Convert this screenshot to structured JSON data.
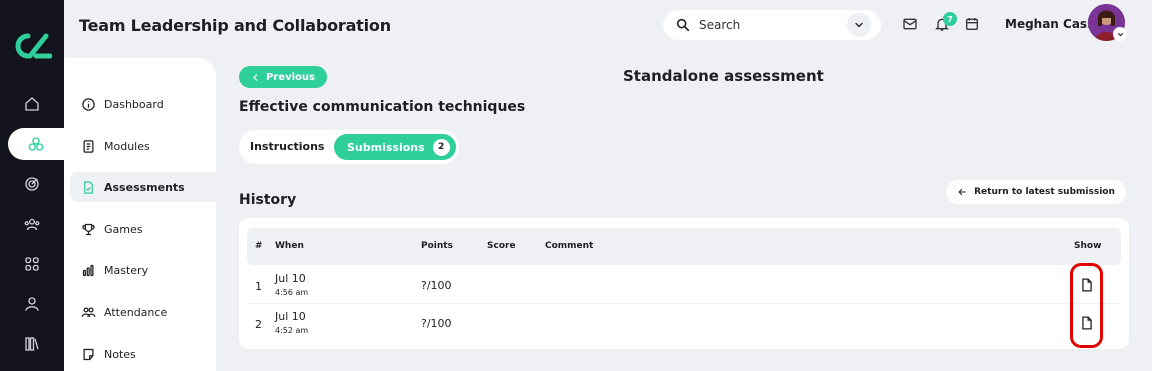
{
  "header": {
    "title": "Team Leadership and Collaboration",
    "search_placeholder": "Search",
    "notification_count": "7",
    "user_name": "Meghan Cass"
  },
  "rail": {
    "items": [
      "home-icon",
      "modules-icon",
      "target-icon",
      "team-icon",
      "grid-icon",
      "user-icon",
      "library-icon"
    ],
    "active_index": 1
  },
  "sidebar": {
    "items": [
      {
        "label": "Dashboard",
        "icon": "info-icon"
      },
      {
        "label": "Modules",
        "icon": "book-icon"
      },
      {
        "label": "Assessments",
        "icon": "assessment-icon",
        "active": true
      },
      {
        "label": "Games",
        "icon": "trophy-icon"
      },
      {
        "label": "Mastery",
        "icon": "bar-chart-icon"
      },
      {
        "label": "Attendance",
        "icon": "people-icon"
      },
      {
        "label": "Notes",
        "icon": "note-icon"
      }
    ]
  },
  "main": {
    "previous_label": "Previous",
    "page_title": "Standalone assessment",
    "subtitle": "Effective communication techniques",
    "tabs": {
      "instructions": "Instructions",
      "submissions": "Submissions",
      "submissions_count": "2"
    },
    "history_title": "History",
    "return_label": "Return to latest submission",
    "table": {
      "headers": {
        "num": "#",
        "when": "When",
        "points": "Points",
        "score": "Score",
        "comment": "Comment",
        "show": "Show"
      },
      "rows": [
        {
          "num": "1",
          "date": "Jul 10",
          "time": "4:56 am",
          "points": "?/100",
          "score": "",
          "comment": ""
        },
        {
          "num": "2",
          "date": "Jul 10",
          "time": "4:52 am",
          "points": "?/100",
          "score": "",
          "comment": ""
        }
      ]
    }
  },
  "colors": {
    "accent": "#2ecf9b",
    "rail_bg": "#12131c",
    "page_bg": "#eef0f3",
    "highlight": "#e30000"
  }
}
